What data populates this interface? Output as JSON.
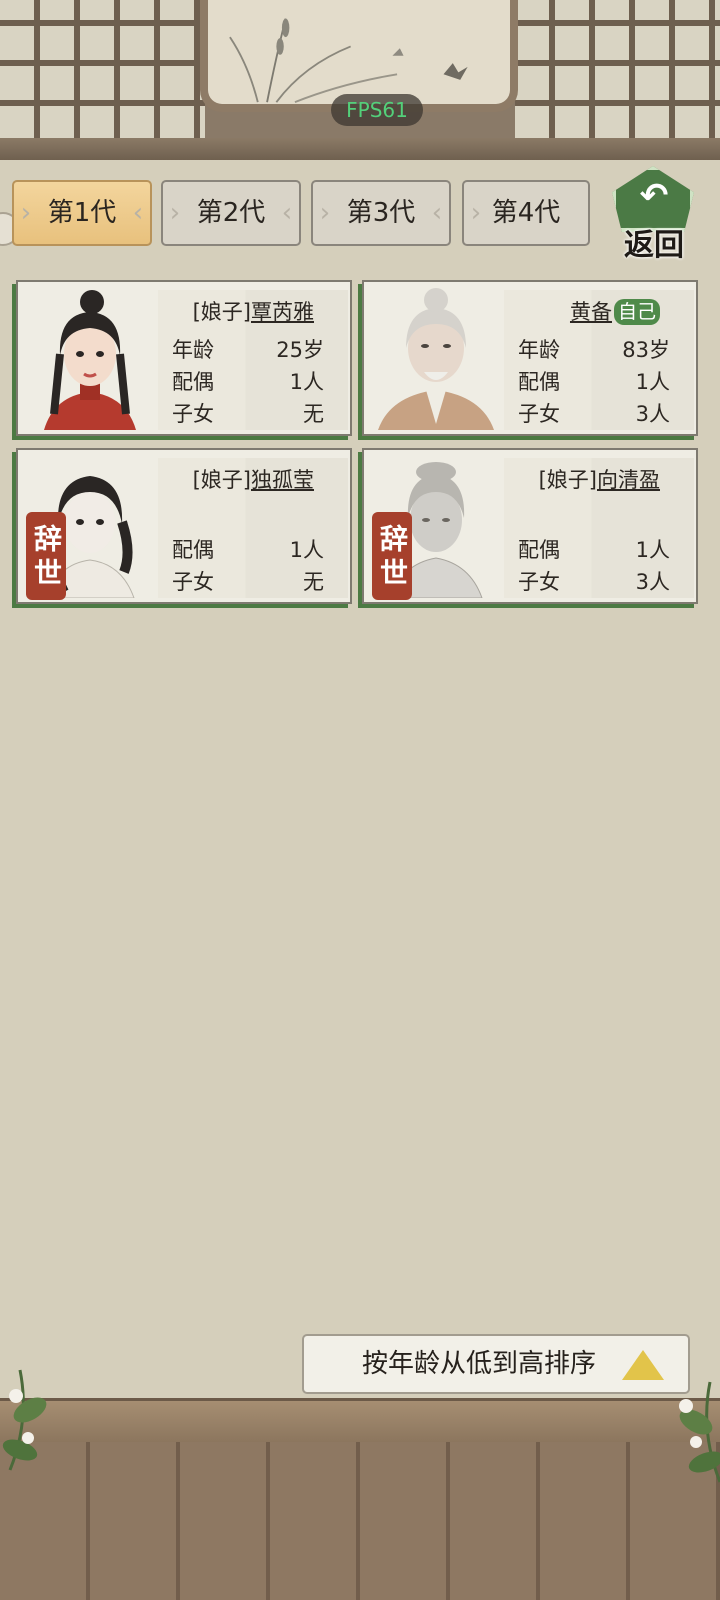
{
  "fps": "FPS61",
  "tabs": [
    {
      "label": "第1代",
      "active": true
    },
    {
      "label": "第2代",
      "active": false
    },
    {
      "label": "第3代",
      "active": false
    },
    {
      "label": "第4代",
      "active": false
    }
  ],
  "back_label": "返回",
  "cards": [
    {
      "title_prefix": "[娘子]",
      "name": "覃芮雅",
      "self_tag": "",
      "stats": [
        {
          "label": "年龄",
          "value": "25岁"
        },
        {
          "label": "配偶",
          "value": "1人"
        },
        {
          "label": "子女",
          "value": "无"
        }
      ],
      "deceased": ""
    },
    {
      "title_prefix": "",
      "name": "黄备",
      "self_tag": "自己",
      "stats": [
        {
          "label": "年龄",
          "value": "83岁"
        },
        {
          "label": "配偶",
          "value": "1人"
        },
        {
          "label": "子女",
          "value": "3人"
        }
      ],
      "deceased": ""
    },
    {
      "title_prefix": "[娘子]",
      "name": "独孤莹",
      "self_tag": "",
      "stats": [
        {
          "label": "配偶",
          "value": "1人"
        },
        {
          "label": "子女",
          "value": "无"
        }
      ],
      "deceased": "辞世"
    },
    {
      "title_prefix": "[娘子]",
      "name": "向清盈",
      "self_tag": "",
      "stats": [
        {
          "label": "配偶",
          "value": "1人"
        },
        {
          "label": "子女",
          "value": "3人"
        }
      ],
      "deceased": "辞世"
    }
  ],
  "sort_label": "按年龄从低到高排序",
  "colors": {
    "accent_green": "#4f8a4a",
    "active_tab": "#e8c17d",
    "deceased_seal": "#a6402c",
    "fps_text": "#53d07a"
  }
}
